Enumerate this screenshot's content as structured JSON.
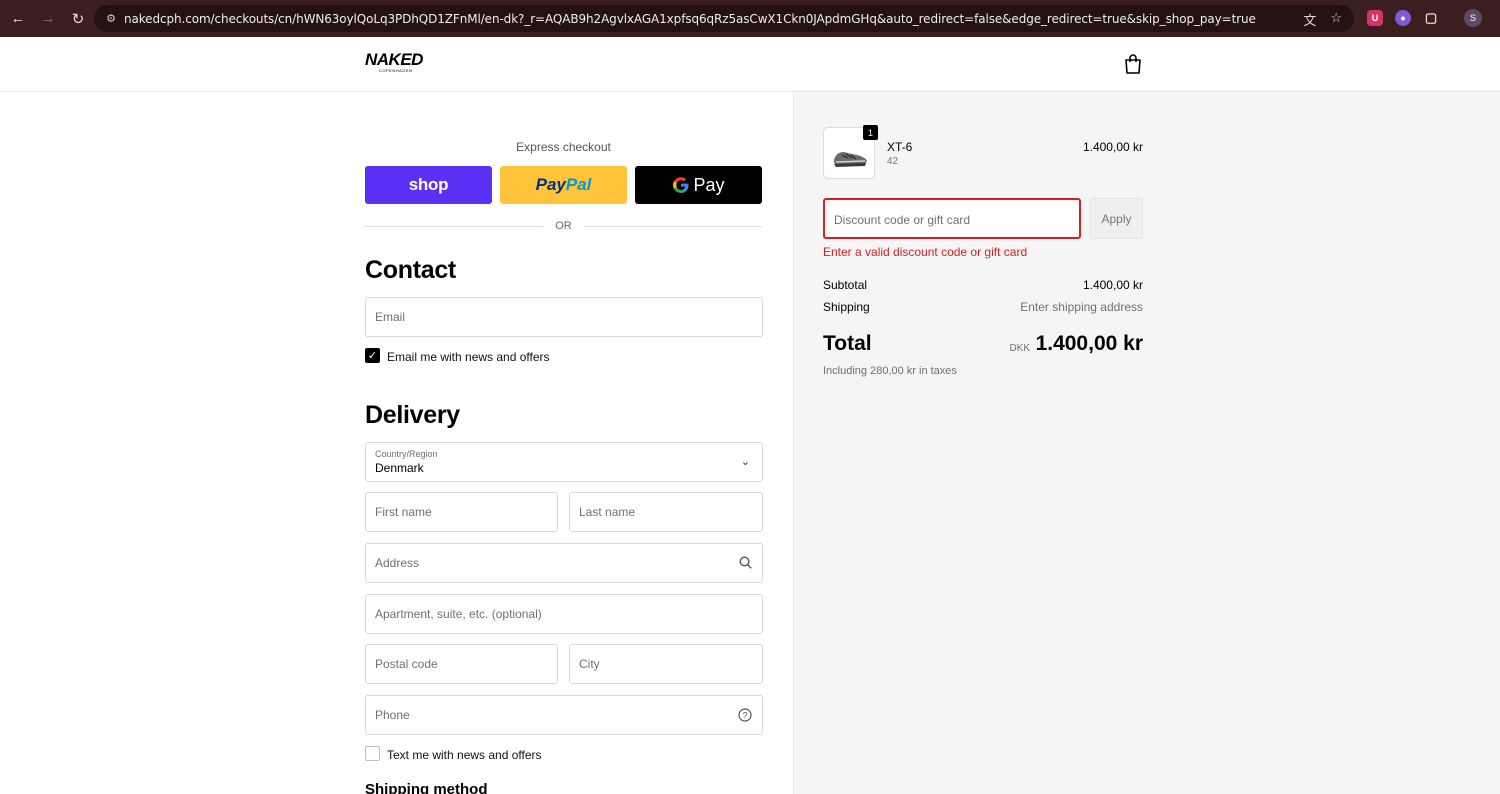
{
  "browser": {
    "url": "nakedcph.com/checkouts/cn/hWN63oylQoLq3PDhQD1ZFnMl/en-dk?_r=AQAB9h2AgvlxAGA1xpfsq6qRz5asCwX1Ckn0JApdmGHq&auto_redirect=false&edge_redirect=true&skip_shop_pay=true",
    "profile_initial": "S"
  },
  "brand": {
    "name": "NAKED",
    "sub": "COPENHAGEN"
  },
  "express": {
    "label": "Express checkout",
    "shop_label": "shop",
    "paypal_part1": "Pay",
    "paypal_part2": "Pal",
    "gpay_label": "Pay",
    "or_label": "OR"
  },
  "contact": {
    "heading": "Contact",
    "email_placeholder": "Email",
    "newsletter_label": "Email me with news and offers",
    "newsletter_checked": true
  },
  "delivery": {
    "heading": "Delivery",
    "country_label": "Country/Region",
    "country_value": "Denmark",
    "first_name_placeholder": "First name",
    "last_name_placeholder": "Last name",
    "address_placeholder": "Address",
    "apartment_placeholder": "Apartment, suite, etc. (optional)",
    "postal_placeholder": "Postal code",
    "city_placeholder": "City",
    "phone_placeholder": "Phone",
    "sms_label": "Text me with news and offers",
    "sms_checked": false,
    "shipping_method_heading": "Shipping method"
  },
  "summary": {
    "product": {
      "name": "XT-6",
      "variant": "42",
      "price": "1.400,00 kr",
      "quantity": "1"
    },
    "discount_placeholder": "Discount code or gift card",
    "apply_label": "Apply",
    "discount_error": "Enter a valid discount code or gift card",
    "subtotal_label": "Subtotal",
    "subtotal_value": "1.400,00 kr",
    "shipping_label": "Shipping",
    "shipping_value": "Enter shipping address",
    "total_label": "Total",
    "total_currency": "DKK",
    "total_value": "1.400,00 kr",
    "taxes_note": "Including 280,00 kr in taxes"
  },
  "colors": {
    "chrome": "#3b1f1f",
    "shop_pay": "#5a31f4",
    "paypal": "#ffc439",
    "error": "#dd1d1d"
  }
}
